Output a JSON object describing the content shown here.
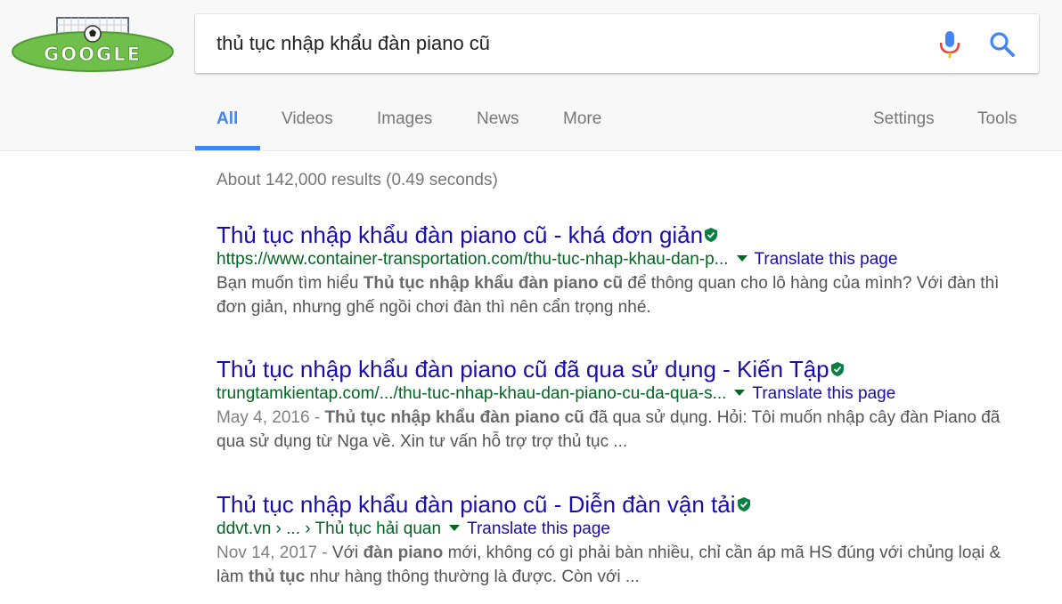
{
  "logo": {
    "text": "GOOGLE"
  },
  "search": {
    "query": "thủ tục nhập khẩu đàn piano cũ"
  },
  "tabs": [
    {
      "label": "All"
    },
    {
      "label": "Videos"
    },
    {
      "label": "Images"
    },
    {
      "label": "News"
    },
    {
      "label": "More"
    }
  ],
  "tools_nav": {
    "settings": "Settings",
    "tools": "Tools"
  },
  "stats": "About 142,000 results (0.49 seconds)",
  "results": [
    {
      "title": "Thủ tục nhập khẩu đàn piano cũ - khá đơn giản",
      "url": "https://www.container-transportation.com/thu-tuc-nhap-khau-dan-p...",
      "translate": "Translate this page",
      "snippet_a": "Bạn muốn tìm hiểu ",
      "snippet_b1": "Thủ tục nhập khẩu đàn piano cũ",
      "snippet_c": " để thông quan cho lô hàng của mình? Với đàn thì đơn giản, nhưng ghế ngồi chơi đàn thì nên cẩn trọng nhé."
    },
    {
      "title": "Thủ tục nhập khẩu đàn piano cũ đã qua sử dụng - Kiến Tập",
      "url": "trungtamkientap.com/.../thu-tuc-nhap-khau-dan-piano-cu-da-qua-s...",
      "translate": "Translate this page",
      "date": "May 4, 2016 - ",
      "snippet_b1": "Thủ tục nhập khẩu đàn piano cũ",
      "snippet_c": " đã qua sử dụng. Hỏi: Tôi muốn nhập cây đàn Piano đã qua sử dụng từ Nga về. Xin tư vấn hỗ trợ trợ thủ tục ..."
    },
    {
      "title": "Thủ tục nhập khẩu đàn piano cũ - Diễn đàn vận tải",
      "url": "ddvt.vn › ... › Thủ tục hải quan",
      "translate": "Translate this page",
      "date": "Nov 14, 2017 - ",
      "snippet_a": "Với ",
      "snippet_b1": "đàn piano",
      "snippet_c": " mới, không có gì phải bàn nhiều, chỉ cần áp mã HS đúng với chủng loại & làm ",
      "snippet_b2": "thủ tục",
      "snippet_d": " như hàng thông thường là được. Còn với ..."
    }
  ],
  "colors": {
    "link": "#1a0dab",
    "url_green": "#006621",
    "accent_blue": "#4285f4",
    "verified_green": "#0b8043"
  },
  "icons": [
    "google-doodle-logo",
    "mic-icon",
    "search-icon",
    "verified-shield-icon",
    "dropdown-caret-icon"
  ]
}
